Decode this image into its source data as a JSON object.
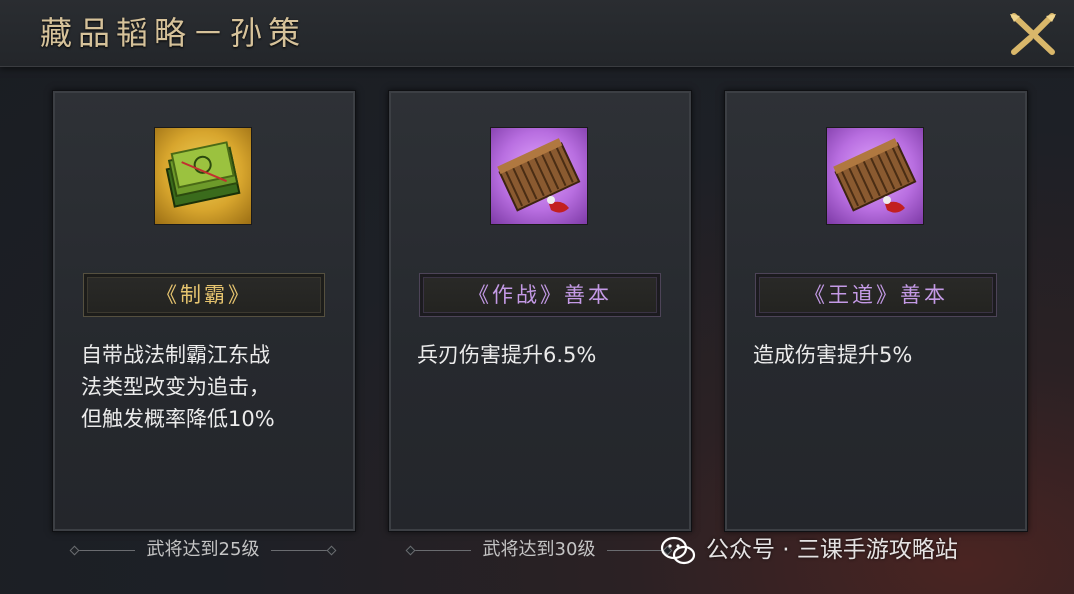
{
  "header": {
    "title": "藏品韬略－孙策"
  },
  "icons": {
    "close": "close-x-icon"
  },
  "colors": {
    "title": "#d6c29a",
    "gold_name": "#e6c46f",
    "purple_name": "#c49ae6"
  },
  "cards": [
    {
      "icon": "gold-book-icon",
      "name": "《制霸》",
      "desc": "自带战法制霸江东战\n法类型改变为追击，\n但触发概率降低10%",
      "requirement": "武将达到25级"
    },
    {
      "icon": "purple-book-icon",
      "name": "《作战》善本",
      "desc": "兵刃伤害提升6.5%",
      "requirement": "武将达到30级"
    },
    {
      "icon": "purple-book-icon",
      "name": "《王道》善本",
      "desc": "造成伤害提升5%",
      "requirement": ""
    }
  ],
  "watermark": {
    "text": "公众号 · 三课手游攻略站",
    "icon": "wechat-logo-icon"
  }
}
